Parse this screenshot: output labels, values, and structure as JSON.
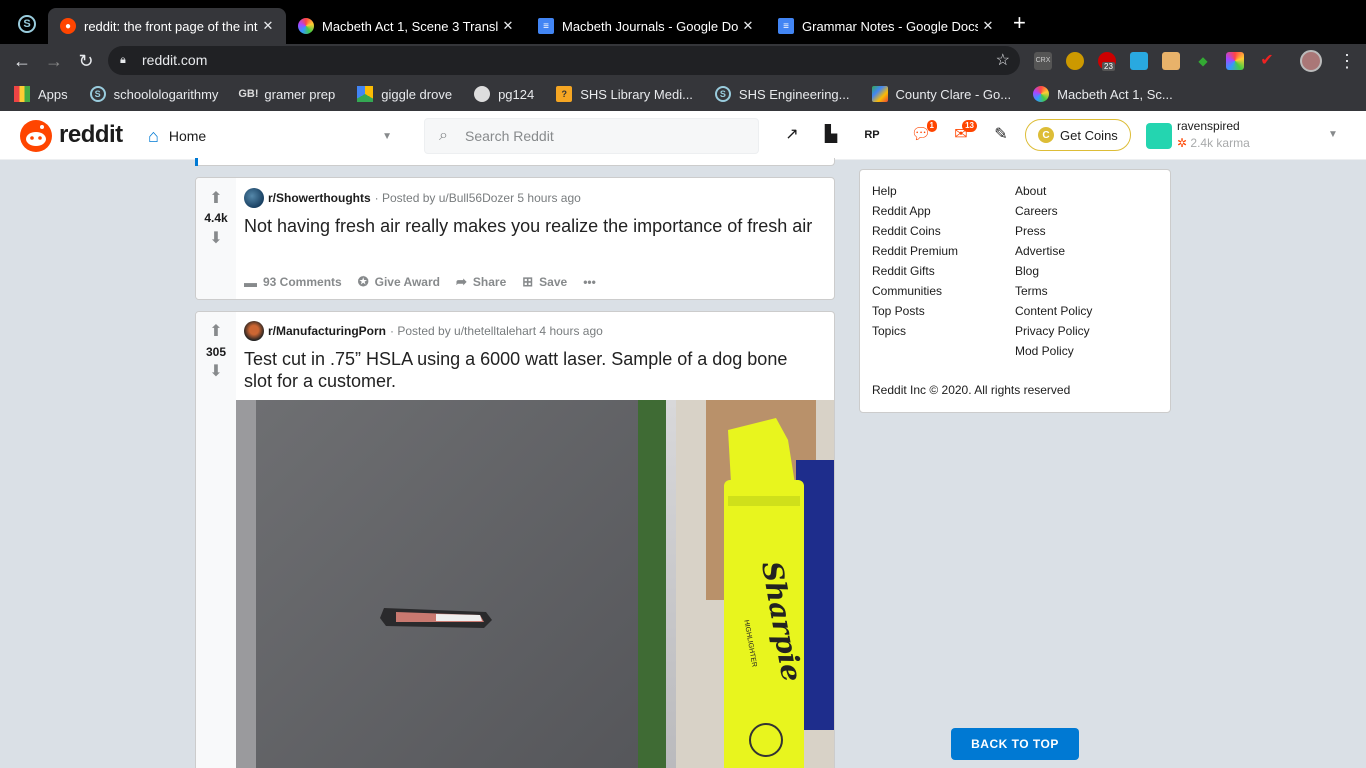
{
  "browser": {
    "tabs": [
      {
        "title": "reddit: the front page of the int",
        "active": true,
        "icon": "reddit-icon",
        "color": "#ff4500"
      },
      {
        "title": "Macbeth Act 1, Scene 3 Transla",
        "active": false,
        "icon": "colorwheel-icon",
        "color": "#ffffff"
      },
      {
        "title": "Macbeth Journals - Google Doc",
        "active": false,
        "icon": "google-docs-icon",
        "color": "#4285f4"
      },
      {
        "title": "Grammar Notes - Google Docs",
        "active": false,
        "icon": "google-docs-icon",
        "color": "#4285f4"
      }
    ],
    "url": "reddit.com",
    "extension_badge": "23",
    "bookmarks": [
      {
        "label": "Apps",
        "icon": "apps-grid-icon"
      },
      {
        "label": "schoolologarithmy",
        "icon": "schoology-icon"
      },
      {
        "label": "gramer prep",
        "icon": "gb-icon"
      },
      {
        "label": "giggle drove",
        "icon": "google-drive-icon"
      },
      {
        "label": "pg124",
        "icon": "globe-icon"
      },
      {
        "label": "SHS Library Medi...",
        "icon": "library-icon"
      },
      {
        "label": "SHS Engineering...",
        "icon": "schoology-icon"
      },
      {
        "label": "County Clare - Go...",
        "icon": "google-maps-icon"
      },
      {
        "label": "Macbeth Act 1, Sc...",
        "icon": "colorwheel-icon"
      }
    ]
  },
  "header": {
    "logo_text": "reddit",
    "home_label": "Home",
    "search_placeholder": "Search Reddit",
    "chat_badge": "1",
    "mail_badge": "13",
    "get_coins": "Get Coins",
    "username": "ravenspired",
    "karma": "2.4k karma"
  },
  "posts": [
    {
      "score": "4.4k",
      "subreddit": "r/Showerthoughts",
      "posted_by": "· Posted by u/Bull56Dozer 5 hours ago",
      "title": "Not having fresh air really makes you realize the importance of fresh air",
      "comments": "93 Comments",
      "award": "Give Award",
      "share": "Share",
      "save": "Save"
    },
    {
      "score": "305",
      "subreddit": "r/ManufacturingPorn",
      "posted_by": "· Posted by u/thetelltalehart 4 hours ago",
      "title": "Test cut in .75” HSLA using a 6000 watt laser. Sample of a dog bone slot for a customer."
    }
  ],
  "image_text": {
    "brand": "Sharpie",
    "sub": "HIGHLIGHTER"
  },
  "sidebar": {
    "left_links": [
      "Help",
      "Reddit App",
      "Reddit Coins",
      "Reddit Premium",
      "Reddit Gifts",
      "Communities",
      "Top Posts",
      "Topics"
    ],
    "right_links": [
      "About",
      "Careers",
      "Press",
      "Advertise",
      "Blog",
      "Terms",
      "Content Policy",
      "Privacy Policy",
      "Mod Policy"
    ],
    "copyright": "Reddit Inc © 2020. All rights reserved"
  },
  "back_to_top": "BACK TO TOP",
  "colors": {
    "reddit_orange": "#ff4500",
    "blue": "#0079d3",
    "page_bg": "#dae0e6",
    "highlighter": "#e8f51e"
  }
}
